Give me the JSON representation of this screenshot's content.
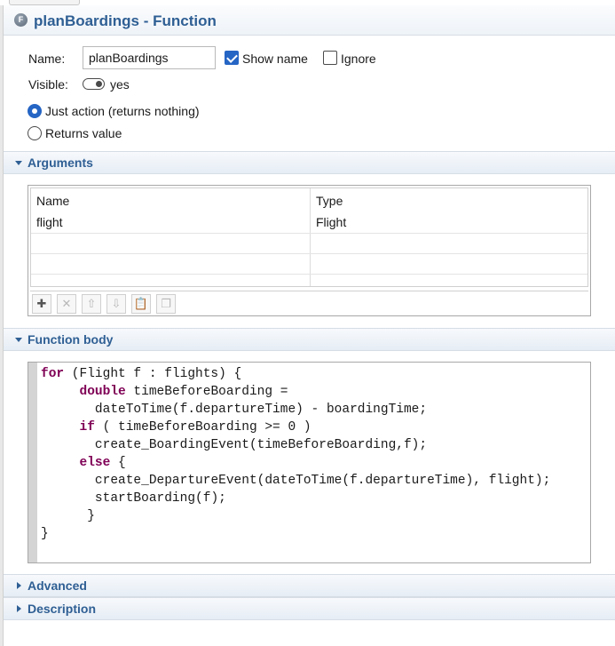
{
  "header": {
    "icon": "function-icon",
    "title": "planBoardings - Function"
  },
  "properties": {
    "name_label": "Name:",
    "name_value": "planBoardings",
    "show_name_label": "Show name",
    "show_name_checked": true,
    "ignore_label": "Ignore",
    "ignore_checked": false,
    "visible_label": "Visible:",
    "visible_value": "yes",
    "radio_just_action": "Just action (returns nothing)",
    "radio_returns_value": "Returns value",
    "selected_radio": "just_action"
  },
  "sections": {
    "arguments": {
      "title": "Arguments",
      "expanded": true
    },
    "function_body": {
      "title": "Function body",
      "expanded": true
    },
    "advanced": {
      "title": "Advanced",
      "expanded": false
    },
    "description": {
      "title": "Description",
      "expanded": false
    }
  },
  "arguments_table": {
    "columns": [
      "Name",
      "Type"
    ],
    "rows": [
      {
        "name": "flight",
        "type": "Flight"
      }
    ],
    "toolbar": [
      {
        "icon": "add-icon",
        "enabled": true
      },
      {
        "icon": "delete-icon",
        "enabled": false
      },
      {
        "icon": "move-up-icon",
        "enabled": false
      },
      {
        "icon": "move-down-icon",
        "enabled": false
      },
      {
        "icon": "paste-icon",
        "enabled": true
      },
      {
        "icon": "copy-icon",
        "enabled": false
      }
    ]
  },
  "code": {
    "lines": [
      {
        "kw": "for",
        "rest": " (Flight f : flights) {"
      },
      {
        "indent": "     ",
        "kw": "double",
        "rest": " timeBeforeBoarding ="
      },
      {
        "indent": "       ",
        "kw": "",
        "rest": "dateToTime(f.departureTime) - boardingTime;"
      },
      {
        "indent": "     ",
        "kw": "if",
        "rest": " ( timeBeforeBoarding >= 0 )"
      },
      {
        "indent": "       ",
        "kw": "",
        "rest": "create_BoardingEvent(timeBeforeBoarding,f);"
      },
      {
        "indent": "     ",
        "kw": "else",
        "rest": " {"
      },
      {
        "indent": "       ",
        "kw": "",
        "rest": "create_DepartureEvent(dateToTime(f.departureTime), flight);"
      },
      {
        "indent": "       ",
        "kw": "",
        "rest": "startBoarding(f);"
      },
      {
        "indent": "      ",
        "kw": "",
        "rest": "}"
      },
      {
        "indent": "",
        "kw": "",
        "rest": "}"
      }
    ]
  }
}
